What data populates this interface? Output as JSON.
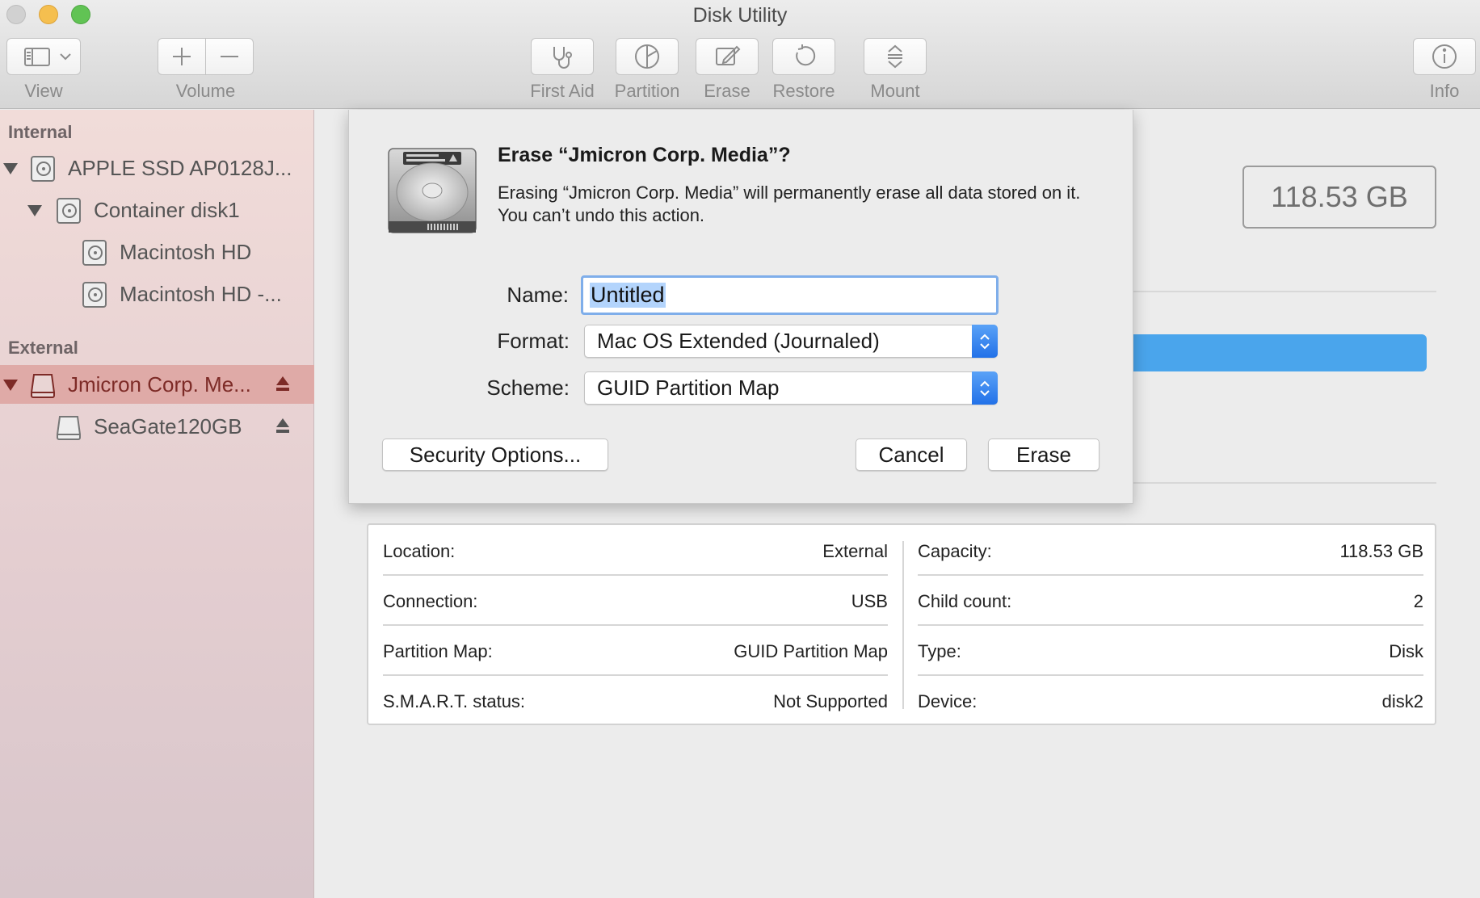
{
  "window": {
    "title": "Disk Utility"
  },
  "toolbar": {
    "view_label": "View",
    "volume_label": "Volume",
    "first_aid_label": "First Aid",
    "partition_label": "Partition",
    "erase_label": "Erase",
    "restore_label": "Restore",
    "mount_label": "Mount",
    "info_label": "Info"
  },
  "sidebar": {
    "internal_header": "Internal",
    "external_header": "External",
    "items": [
      {
        "label": "APPLE SSD AP0128J...",
        "icon": "internal-disk-icon"
      },
      {
        "label": "Container disk1",
        "icon": "container-icon"
      },
      {
        "label": "Macintosh HD",
        "icon": "volume-icon"
      },
      {
        "label": "Macintosh HD -...",
        "icon": "volume-icon"
      },
      {
        "label": "Jmicron Corp. Me...",
        "icon": "external-disk-icon",
        "selected": true
      },
      {
        "label": "SeaGate120GB",
        "icon": "external-volume-icon"
      }
    ]
  },
  "main": {
    "capacity_display": "118.53 GB",
    "usage_fill_fraction": 1.0,
    "info": {
      "left": [
        {
          "label": "Location:",
          "value": "External"
        },
        {
          "label": "Connection:",
          "value": "USB"
        },
        {
          "label": "Partition Map:",
          "value": "GUID Partition Map"
        },
        {
          "label": "S.M.A.R.T. status:",
          "value": "Not Supported"
        }
      ],
      "right": [
        {
          "label": "Capacity:",
          "value": "118.53 GB"
        },
        {
          "label": "Child count:",
          "value": "2"
        },
        {
          "label": "Type:",
          "value": "Disk"
        },
        {
          "label": "Device:",
          "value": "disk2"
        }
      ]
    }
  },
  "dialog": {
    "title": "Erase “Jmicron Corp. Media”?",
    "message": "Erasing “Jmicron Corp. Media” will permanently erase all data stored on it. You can’t undo this action.",
    "name_label": "Name:",
    "name_value": "Untitled",
    "format_label": "Format:",
    "format_value": "Mac OS Extended (Journaled)",
    "scheme_label": "Scheme:",
    "scheme_value": "GUID Partition Map",
    "security_button": "Security Options...",
    "cancel_button": "Cancel",
    "erase_button": "Erase"
  },
  "colors": {
    "accent": "#2271e8",
    "selection": "#dfaaa7",
    "usage": "#4aa5ec"
  }
}
